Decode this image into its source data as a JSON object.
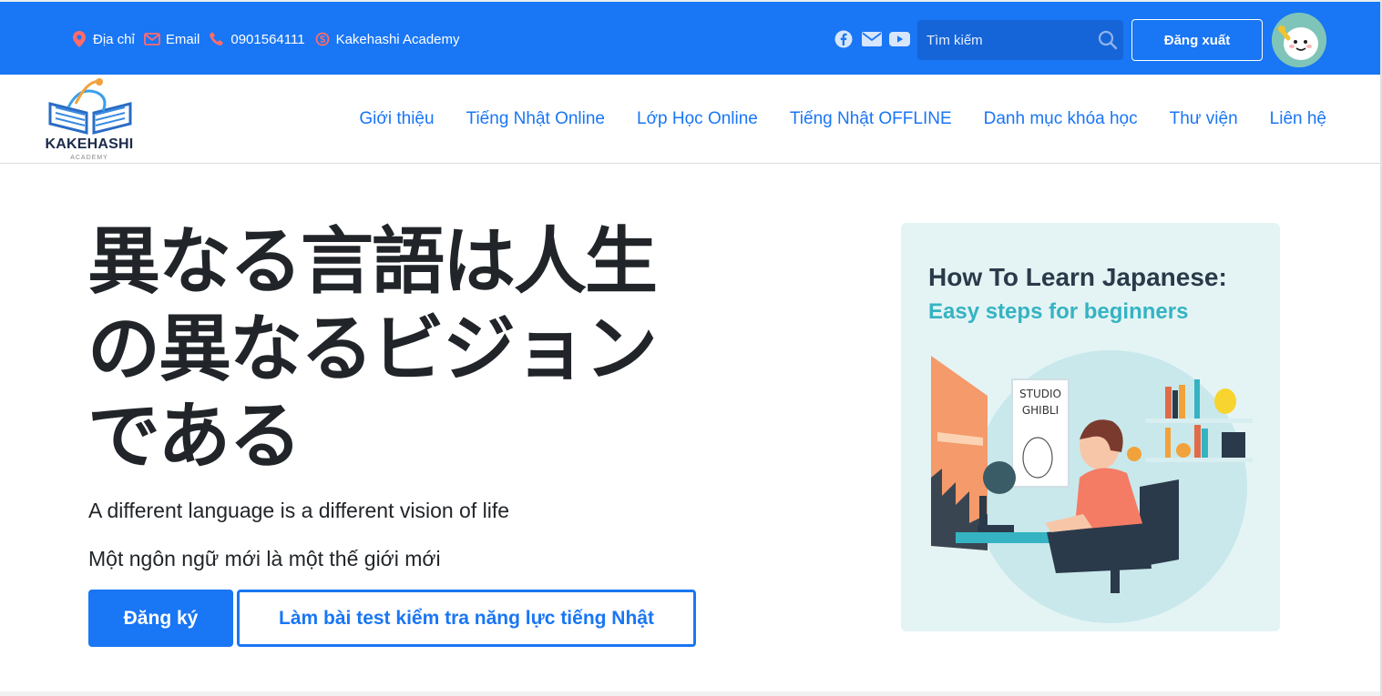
{
  "topbar": {
    "contacts": [
      {
        "icon": "map-pin-icon",
        "label": "Địa chỉ"
      },
      {
        "icon": "email-icon",
        "label": "Email"
      },
      {
        "icon": "phone-icon",
        "label": "0901564111"
      },
      {
        "icon": "skype-icon",
        "label": "Kakehashi Academy"
      }
    ],
    "social": [
      "facebook-icon",
      "envelope-icon",
      "youtube-icon"
    ],
    "search_placeholder": "Tìm kiếm",
    "logout_label": "Đăng xuất",
    "accent_color": "#1976f5"
  },
  "nav": {
    "logo_brand": "KAKEHASHI",
    "logo_sub": "ACADEMY",
    "items": [
      "Giới thiệu",
      "Tiếng Nhật Online",
      "Lớp Học Online",
      "Tiếng Nhật OFFLINE",
      "Danh mục khóa học",
      "Thư viện",
      "Liên hệ"
    ]
  },
  "hero": {
    "headline_line1": "異なる言語は人生",
    "headline_line2": "の異なるビジョン",
    "headline_line3": "である",
    "subtitle_en": "A different language is a different vision of life",
    "subtitle_vi": "Một ngôn ngữ mới là một thế giới mới",
    "register_label": "Đăng ký",
    "test_label": "Làm bài test kiểm tra năng lực tiếng Nhật"
  },
  "illustration": {
    "title": "How To Learn Japanese:",
    "subtitle": "Easy steps for beginners",
    "poster_text": "STUDIO GHIBLI"
  }
}
